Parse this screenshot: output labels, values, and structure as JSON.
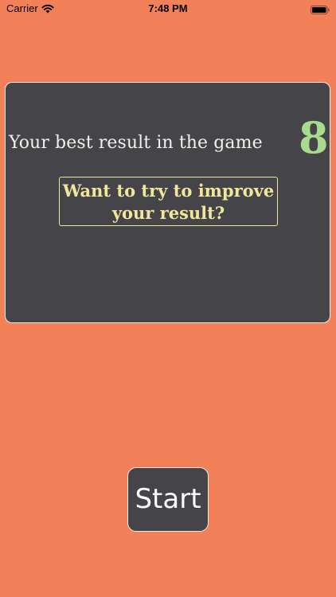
{
  "status_bar": {
    "carrier": "Carrier",
    "time": "7:48 PM",
    "wifi_icon": "wifi-icon",
    "battery_icon": "battery-full-icon"
  },
  "colors": {
    "background": "#F28059",
    "card": "#454449",
    "score": "#A9DB8F",
    "accent_text": "#F1E79A",
    "text": "#F3F0EA"
  },
  "result_card": {
    "label": "Your best result in the game",
    "score": "8",
    "improve_line1": "Want to try to improve",
    "improve_line2": "your result?"
  },
  "start_button": {
    "label": "Start"
  }
}
